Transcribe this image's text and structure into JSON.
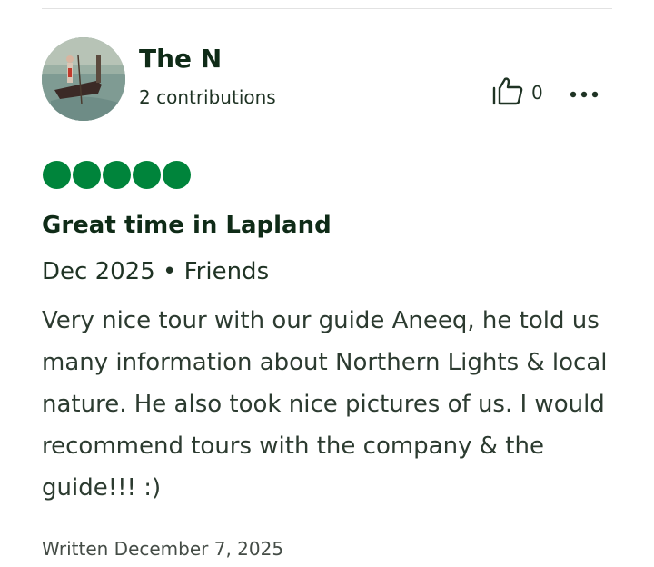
{
  "review": {
    "username": "The N",
    "contributions": "2 contributions",
    "helpful_count": "0",
    "rating": 5,
    "title": "Great time in Lapland",
    "date_line": "Dec 2025 • Friends",
    "body": "Very nice tour with our guide Aneeq, he told us many information about Northern Lights & local nature. He also took nice pictures of us. I would recommend tours with the company & the guide!!! :)",
    "written": "Written December 7, 2025"
  },
  "icons": {
    "helpful": "thumbs-up-icon",
    "more": "more-options-icon",
    "avatar": "avatar-gondola-photo"
  },
  "colors": {
    "bubble": "#00843b",
    "text_dark": "#0f2b17"
  }
}
